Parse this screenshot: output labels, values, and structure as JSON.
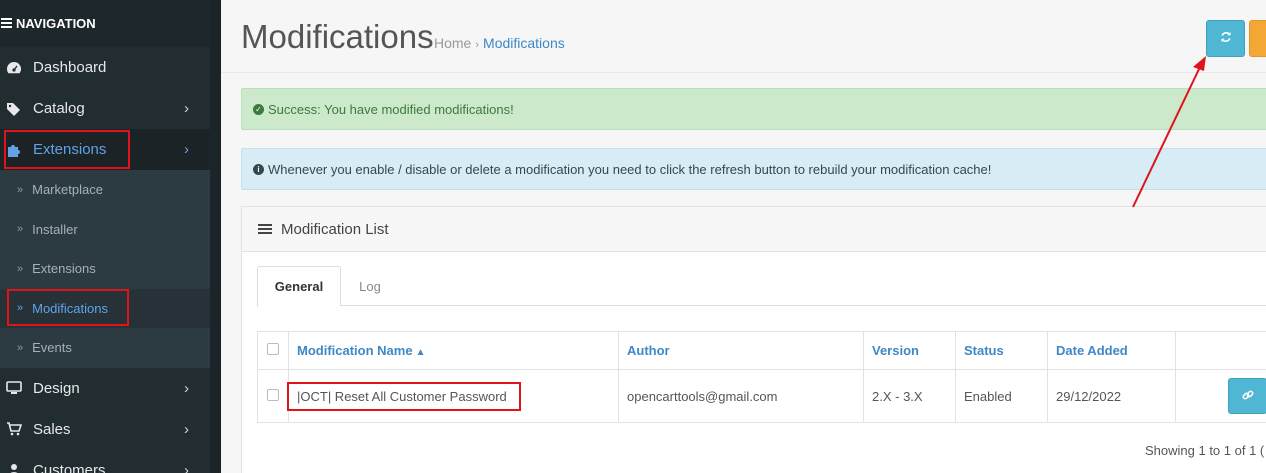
{
  "sidebar": {
    "header": "NAVIGATION",
    "items": [
      {
        "label": "Dashboard",
        "icon": "dashboard-icon"
      },
      {
        "label": "Catalog",
        "icon": "tags-icon"
      },
      {
        "label": "Extensions",
        "icon": "puzzle-icon"
      },
      {
        "label": "Design",
        "icon": "desktop-icon"
      },
      {
        "label": "Sales",
        "icon": "shopping-cart-icon"
      },
      {
        "label": "Customers",
        "icon": "user-icon"
      }
    ],
    "extensions_sub": [
      {
        "label": "Marketplace"
      },
      {
        "label": "Installer"
      },
      {
        "label": "Extensions"
      },
      {
        "label": "Modifications"
      },
      {
        "label": "Events"
      }
    ]
  },
  "header": {
    "title": "Modifications",
    "breadcrumb": [
      "Home",
      "Modifications"
    ],
    "breadcrumb_sep": "›"
  },
  "alerts": {
    "success": "Success: You have modified modifications!",
    "info": "Whenever you enable / disable or delete a modification you need to click the refresh button to rebuild your modification cache!"
  },
  "panel": {
    "title": "Modification List",
    "tabs": [
      "General",
      "Log"
    ]
  },
  "table": {
    "columns": [
      "Modification Name",
      "Author",
      "Version",
      "Status",
      "Date Added"
    ],
    "rows": [
      {
        "name": "|OCT| Reset All Customer Password",
        "author": "opencarttools@gmail.com",
        "version": "2.X - 3.X",
        "status": "Enabled",
        "date_added": "29/12/2022"
      }
    ]
  },
  "pagination": {
    "text": "Showing 1 to 1 of 1 ("
  },
  "colors": {
    "sidebar_bg": "#222d32",
    "accent_blue": "#3d88c7",
    "info_button": "#4fb7d4",
    "warning_button": "#f3a836",
    "highlight_red": "#e0121a"
  }
}
